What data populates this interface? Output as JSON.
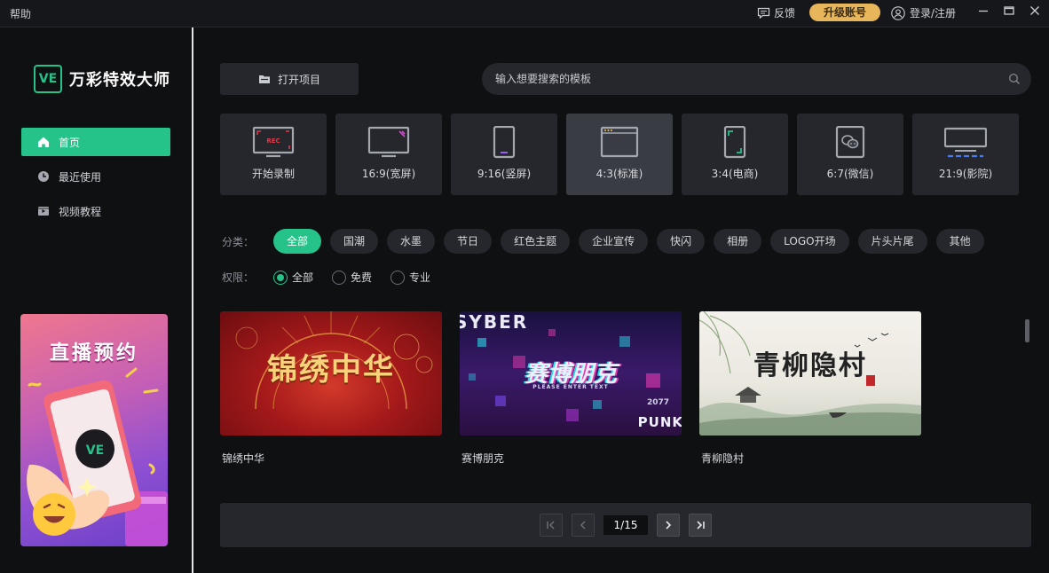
{
  "titlebar": {
    "help": "帮助",
    "feedback": "反馈",
    "upgrade": "升级账号",
    "login": "登录/注册"
  },
  "app": {
    "logo_mark": "VE",
    "name": "万彩特效大师"
  },
  "sidebar": {
    "items": [
      {
        "label": "首页",
        "icon": "home-icon",
        "active": true
      },
      {
        "label": "最近使用",
        "icon": "clock-icon",
        "active": false
      },
      {
        "label": "视频教程",
        "icon": "video-icon",
        "active": false
      }
    ],
    "promo_title": "直播预约",
    "promo_logo": "VE"
  },
  "toolbar": {
    "open_project": "打开项目",
    "search_placeholder": "输入想要搜索的模板"
  },
  "ratios": [
    {
      "label": "开始录制",
      "icon": "record-icon",
      "active": false,
      "badge": "REC"
    },
    {
      "label": "16:9(宽屏)",
      "icon": "widescreen-icon",
      "active": false
    },
    {
      "label": "9:16(竖屏)",
      "icon": "portrait-icon",
      "active": false
    },
    {
      "label": "4:3(标准)",
      "icon": "standard-icon",
      "active": true
    },
    {
      "label": "3:4(电商)",
      "icon": "ecommerce-icon",
      "active": false
    },
    {
      "label": "6:7(微信)",
      "icon": "wechat-icon",
      "active": false
    },
    {
      "label": "21:9(影院)",
      "icon": "cinema-icon",
      "active": false
    }
  ],
  "filters": {
    "category_label": "分类：",
    "categories": [
      {
        "label": "全部",
        "active": true
      },
      {
        "label": "国潮",
        "active": false
      },
      {
        "label": "水墨",
        "active": false
      },
      {
        "label": "节日",
        "active": false
      },
      {
        "label": "红色主题",
        "active": false
      },
      {
        "label": "企业宣传",
        "active": false
      },
      {
        "label": "快闪",
        "active": false
      },
      {
        "label": "相册",
        "active": false
      },
      {
        "label": "LOGO开场",
        "active": false
      },
      {
        "label": "片头片尾",
        "active": false
      },
      {
        "label": "其他",
        "active": false
      }
    ],
    "permission_label": "权限：",
    "permissions": [
      {
        "label": "全部",
        "checked": true
      },
      {
        "label": "免费",
        "checked": false
      },
      {
        "label": "专业",
        "checked": false
      }
    ]
  },
  "templates": [
    {
      "title": "锦绣中华",
      "thumb_text": "锦绣中华"
    },
    {
      "title": "赛博朋克",
      "thumb_text": "赛博朋克",
      "thumb_top": "SYBER",
      "thumb_sub": "PLEASE ENTER TEXT",
      "thumb_year": "2077",
      "thumb_corner": "PUNK"
    },
    {
      "title": "青柳隐村",
      "thumb_text": "青柳隐村"
    }
  ],
  "pagination": {
    "current": "1/15"
  },
  "colors": {
    "accent": "#25c28a",
    "upgrade": "#e8b65a",
    "background": "#0f1012",
    "panel": "#25272c"
  }
}
